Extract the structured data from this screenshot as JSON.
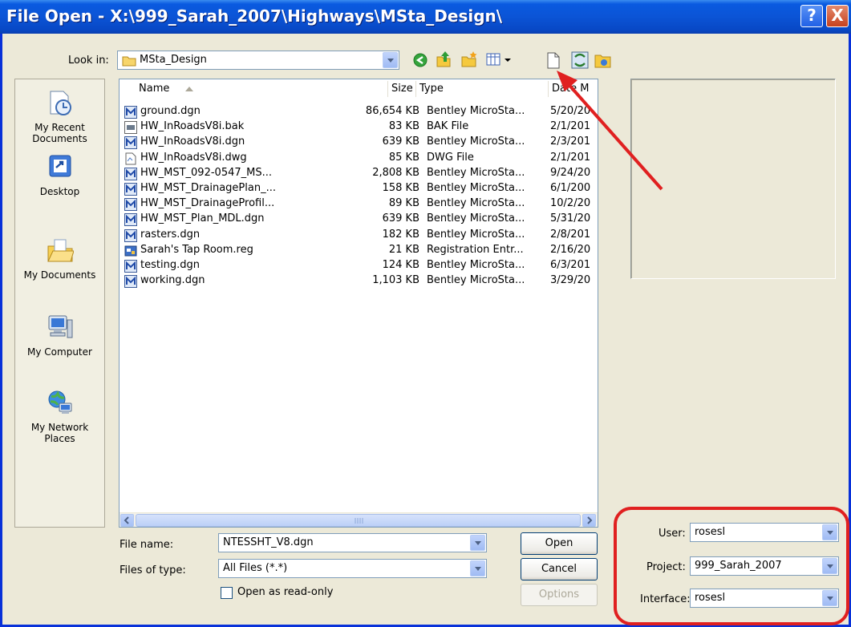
{
  "window": {
    "title": "File Open - X:\\999_Sarah_2007\\Highways\\MSta_Design\\",
    "help_label": "?",
    "close_label": "X"
  },
  "look_in": {
    "label": "Look in:",
    "value": "MSta_Design"
  },
  "places": [
    {
      "label": "My Recent Documents",
      "icon": "recent-documents-icon"
    },
    {
      "label": "Desktop",
      "icon": "desktop-icon"
    },
    {
      "label": "My Documents",
      "icon": "my-documents-icon"
    },
    {
      "label": "My Computer",
      "icon": "my-computer-icon"
    },
    {
      "label": "My Network Places",
      "icon": "network-places-icon"
    }
  ],
  "columns": {
    "name": "Name",
    "size": "Size",
    "type": "Type",
    "date": "Date M"
  },
  "files": [
    {
      "name": "ground.dgn",
      "size": "86,654 KB",
      "type": "Bentley MicroSta...",
      "date": "5/20/20",
      "icon": "microstation-file-icon"
    },
    {
      "name": "HW_InRoadsV8i.bak",
      "size": "83 KB",
      "type": "BAK File",
      "date": "2/1/201",
      "icon": "bak-file-icon"
    },
    {
      "name": "HW_InRoadsV8i.dgn",
      "size": "639 KB",
      "type": "Bentley MicroSta...",
      "date": "2/3/201",
      "icon": "microstation-file-icon"
    },
    {
      "name": "HW_InRoadsV8i.dwg",
      "size": "85 KB",
      "type": "DWG File",
      "date": "2/1/201",
      "icon": "dwg-file-icon"
    },
    {
      "name": "HW_MST_092-0547_MS...",
      "size": "2,808 KB",
      "type": "Bentley MicroSta...",
      "date": "9/24/20",
      "icon": "microstation-file-icon"
    },
    {
      "name": "HW_MST_DrainagePlan_...",
      "size": "158 KB",
      "type": "Bentley MicroSta...",
      "date": "6/1/200",
      "icon": "microstation-file-icon"
    },
    {
      "name": "HW_MST_DrainageProfil...",
      "size": "89 KB",
      "type": "Bentley MicroSta...",
      "date": "10/2/20",
      "icon": "microstation-file-icon"
    },
    {
      "name": "HW_MST_Plan_MDL.dgn",
      "size": "639 KB",
      "type": "Bentley MicroSta...",
      "date": "5/31/20",
      "icon": "microstation-file-icon"
    },
    {
      "name": "rasters.dgn",
      "size": "182 KB",
      "type": "Bentley MicroSta...",
      "date": "2/8/201",
      "icon": "microstation-file-icon"
    },
    {
      "name": "Sarah's Tap Room.reg",
      "size": "21 KB",
      "type": "Registration Entr...",
      "date": "2/16/20",
      "icon": "registry-file-icon"
    },
    {
      "name": "testing.dgn",
      "size": "124 KB",
      "type": "Bentley MicroSta...",
      "date": "6/3/201",
      "icon": "microstation-file-icon"
    },
    {
      "name": "working.dgn",
      "size": "1,103 KB",
      "type": "Bentley MicroSta...",
      "date": "3/29/20",
      "icon": "microstation-file-icon"
    }
  ],
  "file_name": {
    "label": "File name:",
    "value": "NTESSHT_V8.dgn"
  },
  "file_type": {
    "label": "Files of type:",
    "value": "All Files (*.*)"
  },
  "read_only_label": "Open as read-only",
  "buttons": {
    "open": "Open",
    "cancel": "Cancel",
    "options": "Options"
  },
  "workspace": {
    "user_label": "User:",
    "user_value": "rosesl",
    "project_label": "Project:",
    "project_value": "999_Sarah_2007",
    "interface_label": "Interface:",
    "interface_value": "rosesl"
  },
  "colors": {
    "title_bar": "#0b54d6",
    "annotation": "#e02020"
  }
}
